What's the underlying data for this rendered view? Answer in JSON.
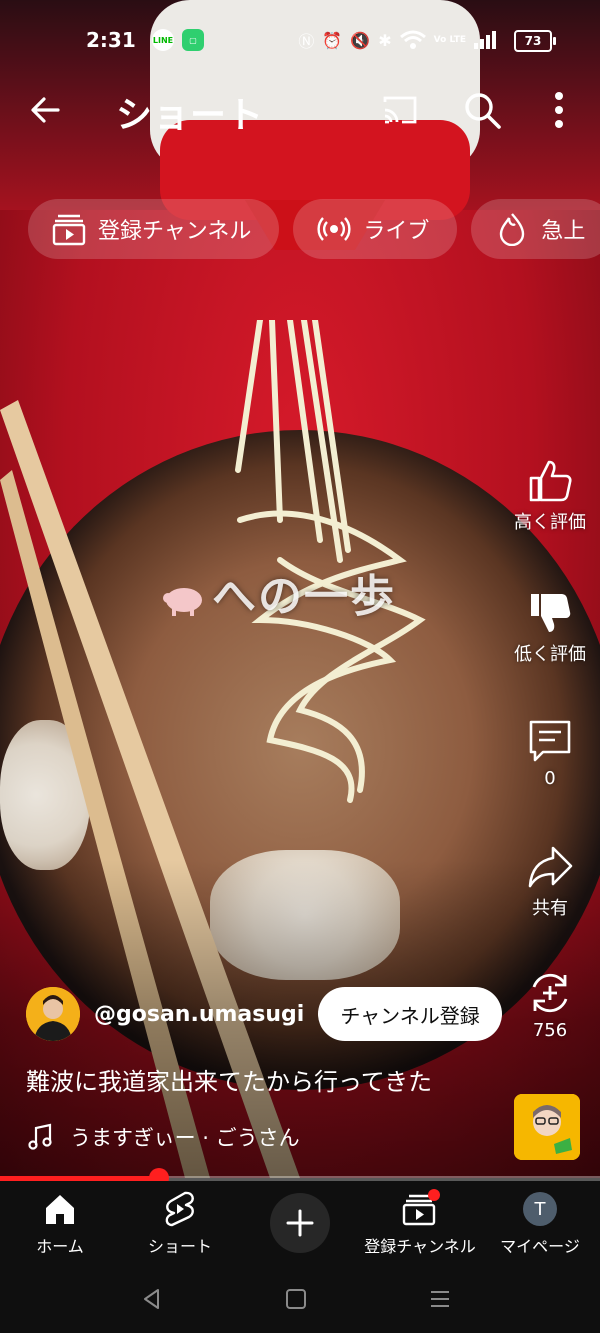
{
  "status_bar": {
    "time": "2:31",
    "battery": "73",
    "network": "Vo LTE",
    "left_icons": [
      "line-icon",
      "app-notification-icon"
    ],
    "right_icons": [
      "nfc-icon",
      "alarm-icon",
      "mute-icon",
      "bluetooth-icon",
      "wifi-icon",
      "volte-icon",
      "signal-icon",
      "battery-icon"
    ]
  },
  "header": {
    "title": "ショート"
  },
  "chips": [
    {
      "label": "登録チャンネル",
      "icon": "subscriptions-icon"
    },
    {
      "label": "ライブ",
      "icon": "live-icon"
    },
    {
      "label": "急上",
      "icon": "trending-icon"
    }
  ],
  "video": {
    "overlay_text": "への一歩"
  },
  "actions": {
    "like_label": "高く評価",
    "dislike_label": "低く評価",
    "comment_count": "0",
    "share_label": "共有",
    "remix_count": "756"
  },
  "channel": {
    "handle": "@gosan.umasugi",
    "subscribe_label": "チャンネル登録"
  },
  "caption": "難波に我道家出来てたから行ってきた",
  "music": {
    "label": "うますぎぃー · ごうさん"
  },
  "progress": {
    "fraction": 0.265
  },
  "bottom_nav": {
    "home": "ホーム",
    "shorts": "ショート",
    "subscriptions": "登録チャンネル",
    "profile": "マイページ",
    "profile_initial": "T"
  },
  "colors": {
    "accent": "#ff1f1f",
    "nav_bg": "#0f0f0f",
    "chip_bg": "rgba(255,255,255,0.18)"
  }
}
